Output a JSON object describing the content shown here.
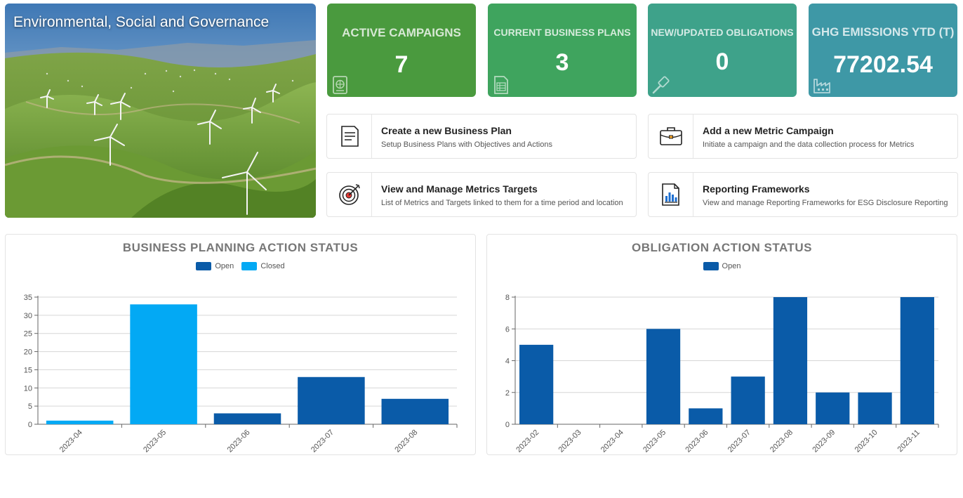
{
  "hero": {
    "title": "Environmental, Social and Governance"
  },
  "kpis": [
    {
      "label": "ACTIVE CAMPAIGNS",
      "value": "7",
      "color": "#4a9a3e",
      "icon": "passport-icon"
    },
    {
      "label": "CURRENT BUSINESS PLANS",
      "value": "3",
      "color": "#3fa45e",
      "icon": "spreadsheet-icon"
    },
    {
      "label": "NEW/UPDATED OBLIGATIONS",
      "value": "0",
      "color": "#3ea28a",
      "icon": "gavel-icon"
    },
    {
      "label": "GHG EMISSIONS YTD (T)",
      "value": "77202.54",
      "color": "#3e98a6",
      "icon": "factory-icon"
    }
  ],
  "actions": [
    {
      "title": "Create a new Business Plan",
      "subtitle": "Setup Business Plans with Objectives and Actions",
      "icon": "document-icon"
    },
    {
      "title": "Add a new Metric Campaign",
      "subtitle": "Initiate a campaign and the data collection process for Metrics",
      "icon": "briefcase-icon"
    },
    {
      "title": "View and Manage Metrics Targets",
      "subtitle": "List of Metrics and Targets linked to them for a time period and location",
      "icon": "target-icon"
    },
    {
      "title": "Reporting Frameworks",
      "subtitle": "View and manage Reporting Frameworks for ESG Disclosure Reporting",
      "icon": "report-chart-icon"
    }
  ],
  "chart_data": [
    {
      "type": "bar",
      "title": "BUSINESS PLANNING ACTION STATUS",
      "categories": [
        "2023-04",
        "2023-05",
        "2023-06",
        "2023-07",
        "2023-08"
      ],
      "series": [
        {
          "name": "Open",
          "color": "#0a5ba8",
          "values": [
            0,
            0,
            3,
            13,
            7
          ]
        },
        {
          "name": "Closed",
          "color": "#03a9f4",
          "values": [
            1,
            33,
            0,
            0,
            0
          ]
        }
      ],
      "stacked": true,
      "yticks": [
        0,
        5,
        10,
        15,
        20,
        25,
        30,
        35
      ],
      "ylim": [
        0,
        35
      ],
      "grid": true,
      "legend": "top"
    },
    {
      "type": "bar",
      "title": "OBLIGATION ACTION STATUS",
      "categories": [
        "2023-02",
        "2023-03",
        "2023-04",
        "2023-05",
        "2023-06",
        "2023-07",
        "2023-08",
        "2023-09",
        "2023-10",
        "2023-11"
      ],
      "series": [
        {
          "name": "Open",
          "color": "#0a5ba8",
          "values": [
            5,
            0,
            0,
            6,
            1,
            3,
            8,
            2,
            2,
            8
          ]
        }
      ],
      "stacked": true,
      "yticks": [
        0,
        2,
        4,
        6,
        8
      ],
      "ylim": [
        0,
        8
      ],
      "grid": true,
      "legend": "top"
    }
  ]
}
